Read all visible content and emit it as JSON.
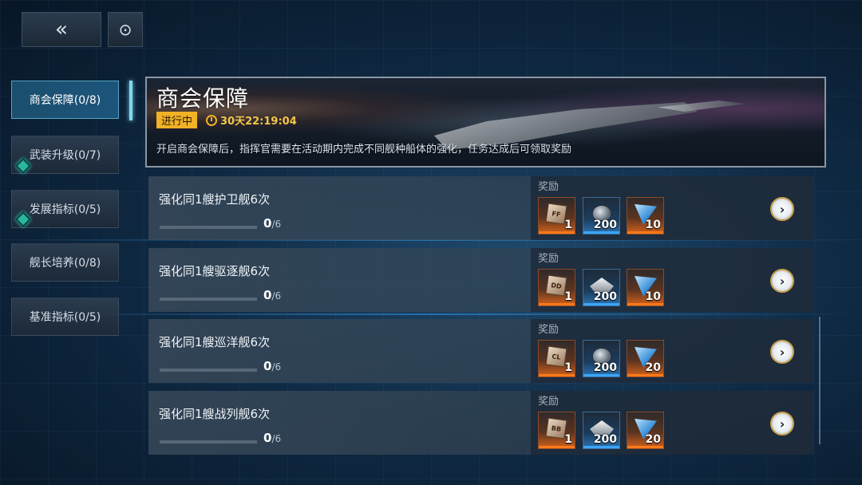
{
  "top": {
    "back_icon": "«",
    "refresh_icon": "⊙"
  },
  "sidebar": {
    "items": [
      {
        "label": "商会保障(0/8)",
        "active": true
      },
      {
        "label": "武装升级(0/7)",
        "gem": true
      },
      {
        "label": "发展指标(0/5)",
        "gem": true
      },
      {
        "label": "舰长培养(0/8)"
      },
      {
        "label": "基准指标(0/5)"
      }
    ]
  },
  "banner": {
    "title": "商会保障",
    "status": "进行中",
    "timer": "30天22:19:04",
    "description": "开启商会保障后，指挥官需要在活动期内完成不同舰种船体的强化，任务达成后可领取奖励"
  },
  "tasks": [
    {
      "title": "强化同1艘护卫舰6次",
      "progress": 0,
      "total": "/6",
      "reward_label": "奖励",
      "rewards": [
        {
          "icon": "ff-cube-icon",
          "code": "FF",
          "count": "1",
          "rarity": "orange"
        },
        {
          "icon": "gear-part-icon",
          "count": "200",
          "rarity": "blue"
        },
        {
          "icon": "blue-crystal-icon",
          "count": "10",
          "rarity": "orange"
        }
      ],
      "go": "›"
    },
    {
      "title": "强化同1艘驱逐舰6次",
      "progress": 0,
      "total": "/6",
      "reward_label": "奖励",
      "rewards": [
        {
          "icon": "dd-cube-icon",
          "code": "DD",
          "count": "1",
          "rarity": "orange"
        },
        {
          "icon": "armor-plate-icon",
          "count": "200",
          "rarity": "blue"
        },
        {
          "icon": "blue-crystal-icon",
          "count": "10",
          "rarity": "orange"
        }
      ],
      "go": "›"
    },
    {
      "title": "强化同1艘巡洋舰6次",
      "progress": 0,
      "total": "/6",
      "reward_label": "奖励",
      "rewards": [
        {
          "icon": "cl-cube-icon",
          "code": "CL",
          "count": "1",
          "rarity": "orange"
        },
        {
          "icon": "gear-part-icon",
          "count": "200",
          "rarity": "blue"
        },
        {
          "icon": "blue-crystal-icon",
          "count": "20",
          "rarity": "orange"
        }
      ],
      "go": "›"
    },
    {
      "title": "强化同1艘战列舰6次",
      "progress": 0,
      "total": "/6",
      "reward_label": "奖励",
      "rewards": [
        {
          "icon": "bb-cube-icon",
          "code": "BB",
          "count": "1",
          "rarity": "orange"
        },
        {
          "icon": "armor-plate-icon",
          "count": "200",
          "rarity": "blue"
        },
        {
          "icon": "blue-crystal-icon",
          "count": "20",
          "rarity": "orange"
        }
      ],
      "go": "›"
    }
  ]
}
